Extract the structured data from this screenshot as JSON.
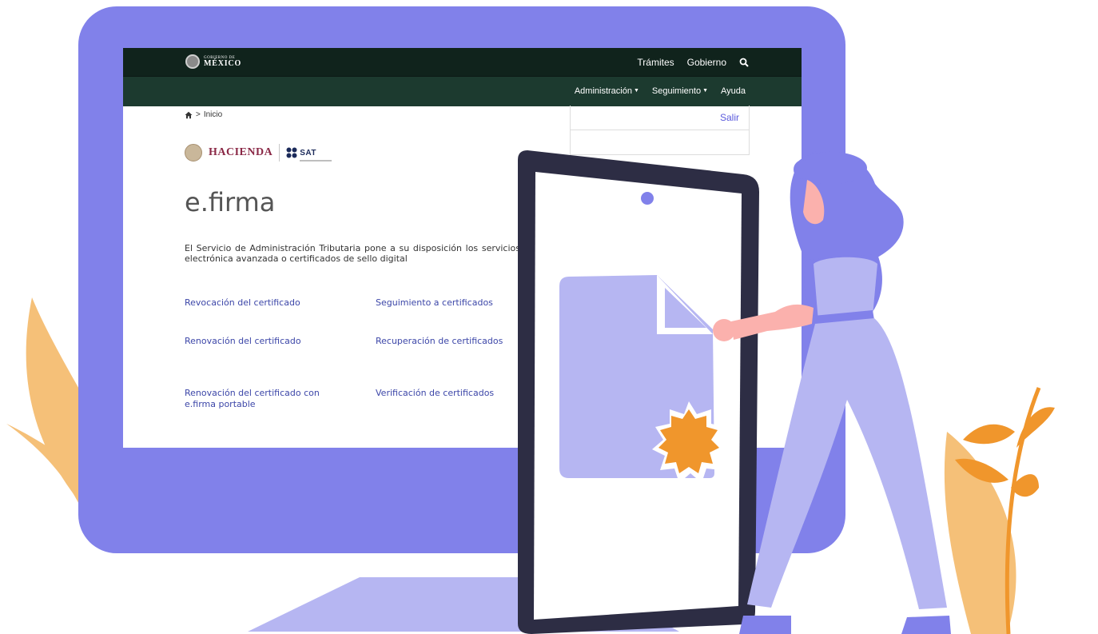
{
  "header": {
    "logo": {
      "small": "GOBIERNO DE",
      "big": "MÉXICO"
    },
    "nav": [
      "Trámites",
      "Gobierno"
    ],
    "search_icon": "search-icon"
  },
  "subnav": {
    "items": [
      "Administración",
      "Seguimiento",
      "Ayuda"
    ]
  },
  "breadcrumb": {
    "home_icon": "home-icon",
    "current": "Inicio"
  },
  "side_panel": {
    "logout": "Salir"
  },
  "brand": {
    "hacienda": "HACIENDA",
    "sat": "SAT"
  },
  "page": {
    "title": "e.firma",
    "intro": "El Servicio de Administración Tributaria pone a su disposición los servicios electrónica avanzada o certificados de sello digital"
  },
  "links": {
    "left": [
      "Revocación del certificado",
      "Renovación del certificado",
      "Renovación del certificado con e.firma portable"
    ],
    "right": [
      "Seguimiento a certificados",
      "Recuperación de certificados",
      "Verificación de certificados"
    ]
  },
  "colors": {
    "monitor": "#8181ea",
    "accent": "#5a5adc",
    "header": "#10231c",
    "subheader": "#1c3a2f",
    "leaves": "#f5c078",
    "seal": "#f0962c",
    "skin": "#fbb1ad"
  }
}
